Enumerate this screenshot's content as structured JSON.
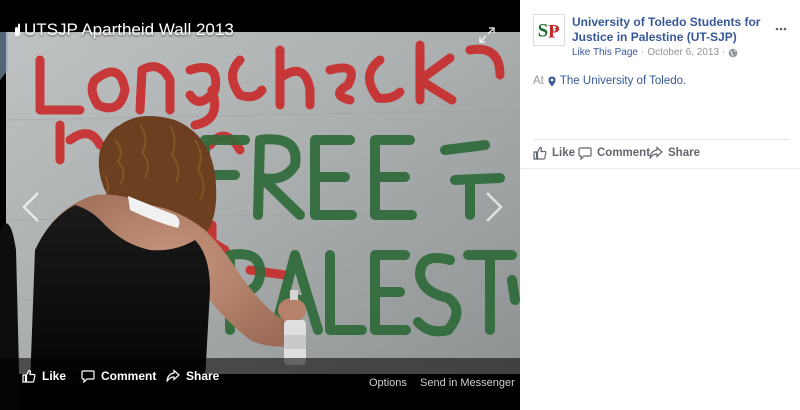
{
  "photo": {
    "album_title": "UTSJP Apartheid Wall 2013",
    "graffiti_upper": "Long check",
    "graffiti_main_1": "FREE",
    "graffiti_main_2": "PALEST",
    "actions": {
      "like": "Like",
      "comment": "Comment",
      "share": "Share"
    },
    "links": {
      "options": "Options",
      "send": "Send in Messenger"
    }
  },
  "post": {
    "page_name": "University of Toledo Students for Justice in Palestine (UT-SJP)",
    "logo_text": "SJP",
    "logo_sub": "UT",
    "like_page": "Like This Page",
    "separator": "·",
    "date": "October 6, 2013",
    "location_prefix": "At",
    "location": "The University of Toledo.",
    "actions": {
      "like": "Like",
      "comment": "Comment",
      "share": "Share"
    }
  },
  "colors": {
    "link_blue": "#365899",
    "meta_grey": "#90949c",
    "action_grey": "#606770",
    "graffiti_red": "#d42a2a",
    "graffiti_green": "#2f6b3a"
  },
  "icons": [
    "hand-icon",
    "expand-icon",
    "chevron-left-icon",
    "chevron-right-icon",
    "like-icon",
    "comment-icon",
    "share-icon",
    "globe-icon",
    "more-icon",
    "pin-icon"
  ]
}
